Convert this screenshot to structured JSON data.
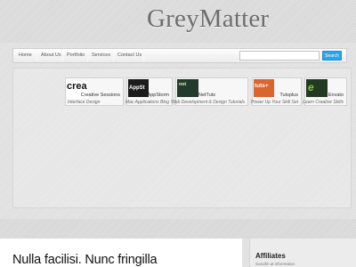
{
  "site": {
    "title": "GreyMatter"
  },
  "nav": {
    "items": [
      "Home",
      "About Us",
      "Portfolio",
      "Services",
      "Contact Us"
    ]
  },
  "search": {
    "value": "",
    "placeholder": "",
    "button_label": "Search"
  },
  "showcase": {
    "cards": [
      {
        "thumb": "crea",
        "name": "Creative Sessions",
        "tagline": "Interface Design"
      },
      {
        "thumb": "AppSt",
        "name": "AppStorm",
        "tagline": "Mac Applications Blog"
      },
      {
        "thumb": "net",
        "name": "NetTuts",
        "tagline": "Web Development & Design Tutorials"
      },
      {
        "thumb": "tuts+",
        "name": "Tutsplus",
        "tagline": "Power Up Your Skill Set"
      },
      {
        "thumb": "e",
        "name": "Envato",
        "tagline": "Learn Creative Skills"
      }
    ]
  },
  "post": {
    "title": "Nulla facilisi. Nunc fringilla"
  },
  "sidebar": {
    "title": "Affiliates",
    "text": "Suscilin at information"
  }
}
